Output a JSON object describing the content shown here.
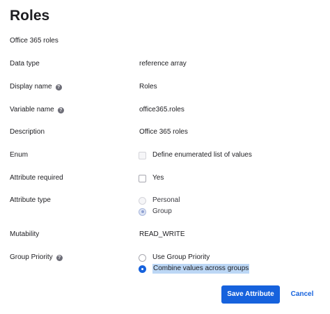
{
  "header": {
    "title": "Roles",
    "subtitle": "Office 365 roles"
  },
  "fields": {
    "data_type": {
      "label": "Data type",
      "value": "reference array"
    },
    "display_name": {
      "label": "Display name",
      "value": "Roles",
      "help_icon": "?"
    },
    "variable_name": {
      "label": "Variable name",
      "value": "office365.roles",
      "help_icon": "?"
    },
    "description": {
      "label": "Description",
      "value": "Office 365 roles"
    },
    "enum": {
      "label": "Enum",
      "option": "Define enumerated list of values",
      "checked": false
    },
    "attribute_required": {
      "label": "Attribute required",
      "option": "Yes",
      "checked": false
    },
    "attribute_type": {
      "label": "Attribute type",
      "options": [
        "Personal",
        "Group"
      ],
      "selected": "Group"
    },
    "mutability": {
      "label": "Mutability",
      "value": "READ_WRITE"
    },
    "group_priority": {
      "label": "Group Priority",
      "help_icon": "?",
      "options": [
        "Use Group Priority",
        "Combine values across groups"
      ],
      "selected": "Combine values across groups"
    }
  },
  "actions": {
    "save_label": "Save Attribute",
    "cancel_label": "Cancel"
  },
  "colors": {
    "primary": "#1662dd",
    "text": "#1d1d21",
    "selection_highlight": "#bcd7f5"
  }
}
